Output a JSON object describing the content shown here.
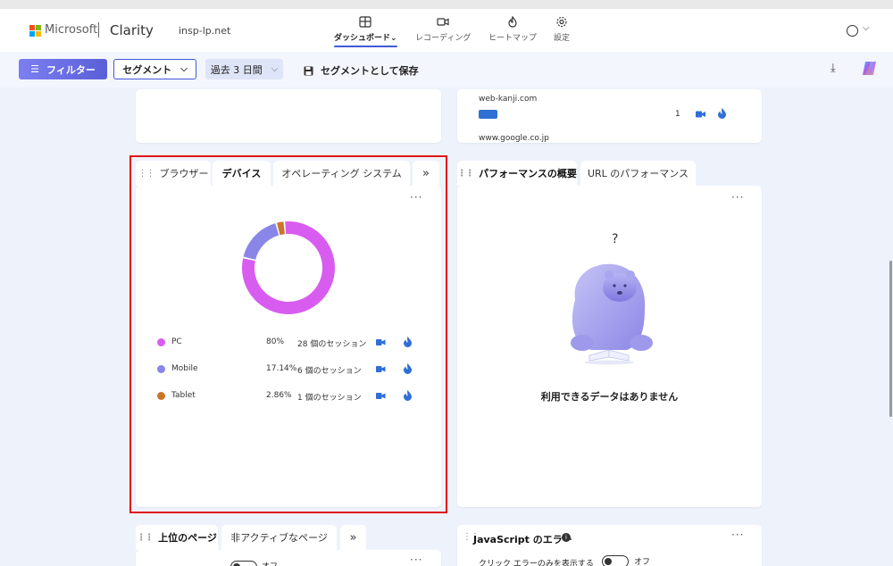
{
  "header": {
    "brand": "Microsoft",
    "app_name": "Clarity",
    "project": "insp-lp.net",
    "nav": [
      {
        "label": "ダッシュボード",
        "icon": "dashboard-icon",
        "active": true
      },
      {
        "label": "レコーディング",
        "icon": "video-camera-icon",
        "active": false
      },
      {
        "label": "ヒートマップ",
        "icon": "flame-icon",
        "active": false
      },
      {
        "label": "設定",
        "icon": "gear-icon",
        "active": false
      }
    ],
    "nav_chevron": "⌄"
  },
  "toolbar": {
    "filter_label": "フィルター",
    "segment_label": "セグメント",
    "period_label": "過去 3 日間",
    "save_segment_label": "セグメントとして保存"
  },
  "top_right_card": {
    "referrer_1": "web-kanji.com",
    "referrer_1_sessions": "1",
    "referrer_2": "www.google.co.jp"
  },
  "device_card": {
    "tabs": [
      "ブラウザー",
      "デバイス",
      "オペレーティング システム"
    ],
    "selected_tab": "デバイス",
    "more_tabs": "»",
    "menu": "···",
    "legend": [
      {
        "name": "PC",
        "percent": "80%",
        "sessions": "28 個のセッション",
        "color": "#d95cf0",
        "value": 80
      },
      {
        "name": "Mobile",
        "percent": "17.14%",
        "sessions": "6 個のセッション",
        "color": "#8a86e8",
        "value": 17.14
      },
      {
        "name": "Tablet",
        "percent": "2.86%",
        "sessions": "1 個のセッション",
        "color": "#c9762b",
        "value": 2.86
      }
    ]
  },
  "performance_card": {
    "tabs": [
      "パフォーマンスの概要",
      "URL のパフォーマンス"
    ],
    "selected_tab": "パフォーマンスの概要",
    "menu": "···",
    "question_mark": "?",
    "empty_message": "利用できるデータはありません"
  },
  "top_pages_card": {
    "tabs": [
      "上位のページ",
      "非アクティブなページ"
    ],
    "more_tabs": "»",
    "menu": "···",
    "toggle_off": "オフ"
  },
  "js_errors_card": {
    "title": "JavaScript のエラー",
    "menu": "···",
    "toggle_label": "クリック エラーのみを表示する",
    "toggle_state": "オフ"
  },
  "colors": {
    "accent": "#4458d8",
    "highlight": "#e0121a",
    "icon_blue": "#2f6fd6"
  }
}
